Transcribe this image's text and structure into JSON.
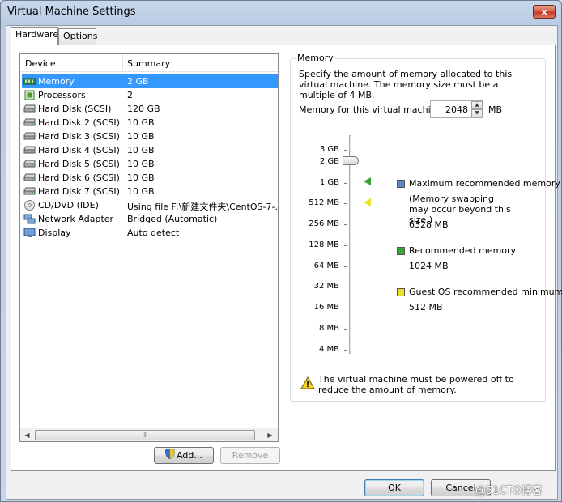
{
  "window": {
    "title": "Virtual Machine Settings",
    "close_label": "x"
  },
  "tabs": [
    {
      "label": "Hardware"
    },
    {
      "label": "Options"
    }
  ],
  "device_list": {
    "col_device": "Device",
    "col_summary": "Summary",
    "rows": [
      {
        "name": "Memory",
        "summary": "2 GB",
        "icon": "memory-icon"
      },
      {
        "name": "Processors",
        "summary": "2",
        "icon": "processor-icon"
      },
      {
        "name": "Hard Disk (SCSI)",
        "summary": "120 GB",
        "icon": "hard-disk-icon"
      },
      {
        "name": "Hard Disk 2 (SCSI)",
        "summary": "10 GB",
        "icon": "hard-disk-icon"
      },
      {
        "name": "Hard Disk 3 (SCSI)",
        "summary": "10 GB",
        "icon": "hard-disk-icon"
      },
      {
        "name": "Hard Disk 4 (SCSI)",
        "summary": "10 GB",
        "icon": "hard-disk-icon"
      },
      {
        "name": "Hard Disk 5 (SCSI)",
        "summary": "10 GB",
        "icon": "hard-disk-icon"
      },
      {
        "name": "Hard Disk 6 (SCSI)",
        "summary": "10 GB",
        "icon": "hard-disk-icon"
      },
      {
        "name": "Hard Disk 7 (SCSI)",
        "summary": "10 GB",
        "icon": "hard-disk-icon"
      },
      {
        "name": "CD/DVD (IDE)",
        "summary": "Using file F:\\新建文件夹\\CentOS-7-...",
        "icon": "cd-dvd-icon"
      },
      {
        "name": "Network Adapter",
        "summary": "Bridged (Automatic)",
        "icon": "network-adapter-icon"
      },
      {
        "name": "Display",
        "summary": "Auto detect",
        "icon": "display-icon"
      }
    ],
    "scroll_thumb": "III"
  },
  "buttons": {
    "add": "Add...",
    "remove": "Remove",
    "ok": "OK",
    "cancel": "Cancel"
  },
  "memory": {
    "group_title": "Memory",
    "description": "Specify the amount of memory allocated to this virtual machine. The memory size must be a multiple of 4 MB.",
    "field_label": "Memory for this virtual machine:",
    "value": "2048",
    "unit": "MB",
    "scale_labels": [
      "3 GB",
      "2 GB",
      "1 GB",
      "512 MB",
      "256 MB",
      "128 MB",
      "64 MB",
      "32 MB",
      "16 MB",
      "8 MB",
      "4 MB"
    ],
    "legend": {
      "max_label": "Maximum recommended memory",
      "max_note": "(Memory swapping may occur beyond this size.)",
      "max_value": "6328 MB",
      "rec_label": "Recommended memory",
      "rec_value": "1024 MB",
      "min_label": "Guest OS recommended minimum",
      "min_value": "512 MB"
    },
    "warning": "The virtual machine must be powered off to reduce the amount of memory."
  },
  "watermark": "@51CTO博客",
  "colors": {
    "selection": "#3399ff",
    "max_marker": "#5b86c5",
    "rec_marker": "#36a336",
    "min_marker": "#e9e12a"
  }
}
